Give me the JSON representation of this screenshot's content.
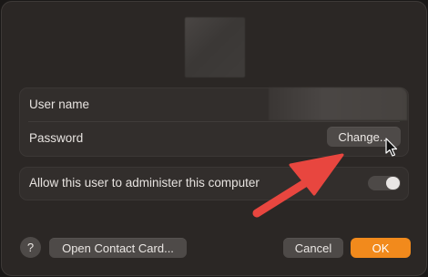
{
  "user_section": {
    "username_label": "User name",
    "password_label": "Password",
    "change_button": "Change..."
  },
  "admin_section": {
    "label": "Allow this user to administer this computer",
    "toggle_on": false
  },
  "footer": {
    "help_button": "?",
    "open_contact_card_button": "Open Contact Card...",
    "cancel_button": "Cancel",
    "ok_button": "OK"
  },
  "colors": {
    "accent": "#f28a1c",
    "annotation_arrow": "#e8463f"
  }
}
